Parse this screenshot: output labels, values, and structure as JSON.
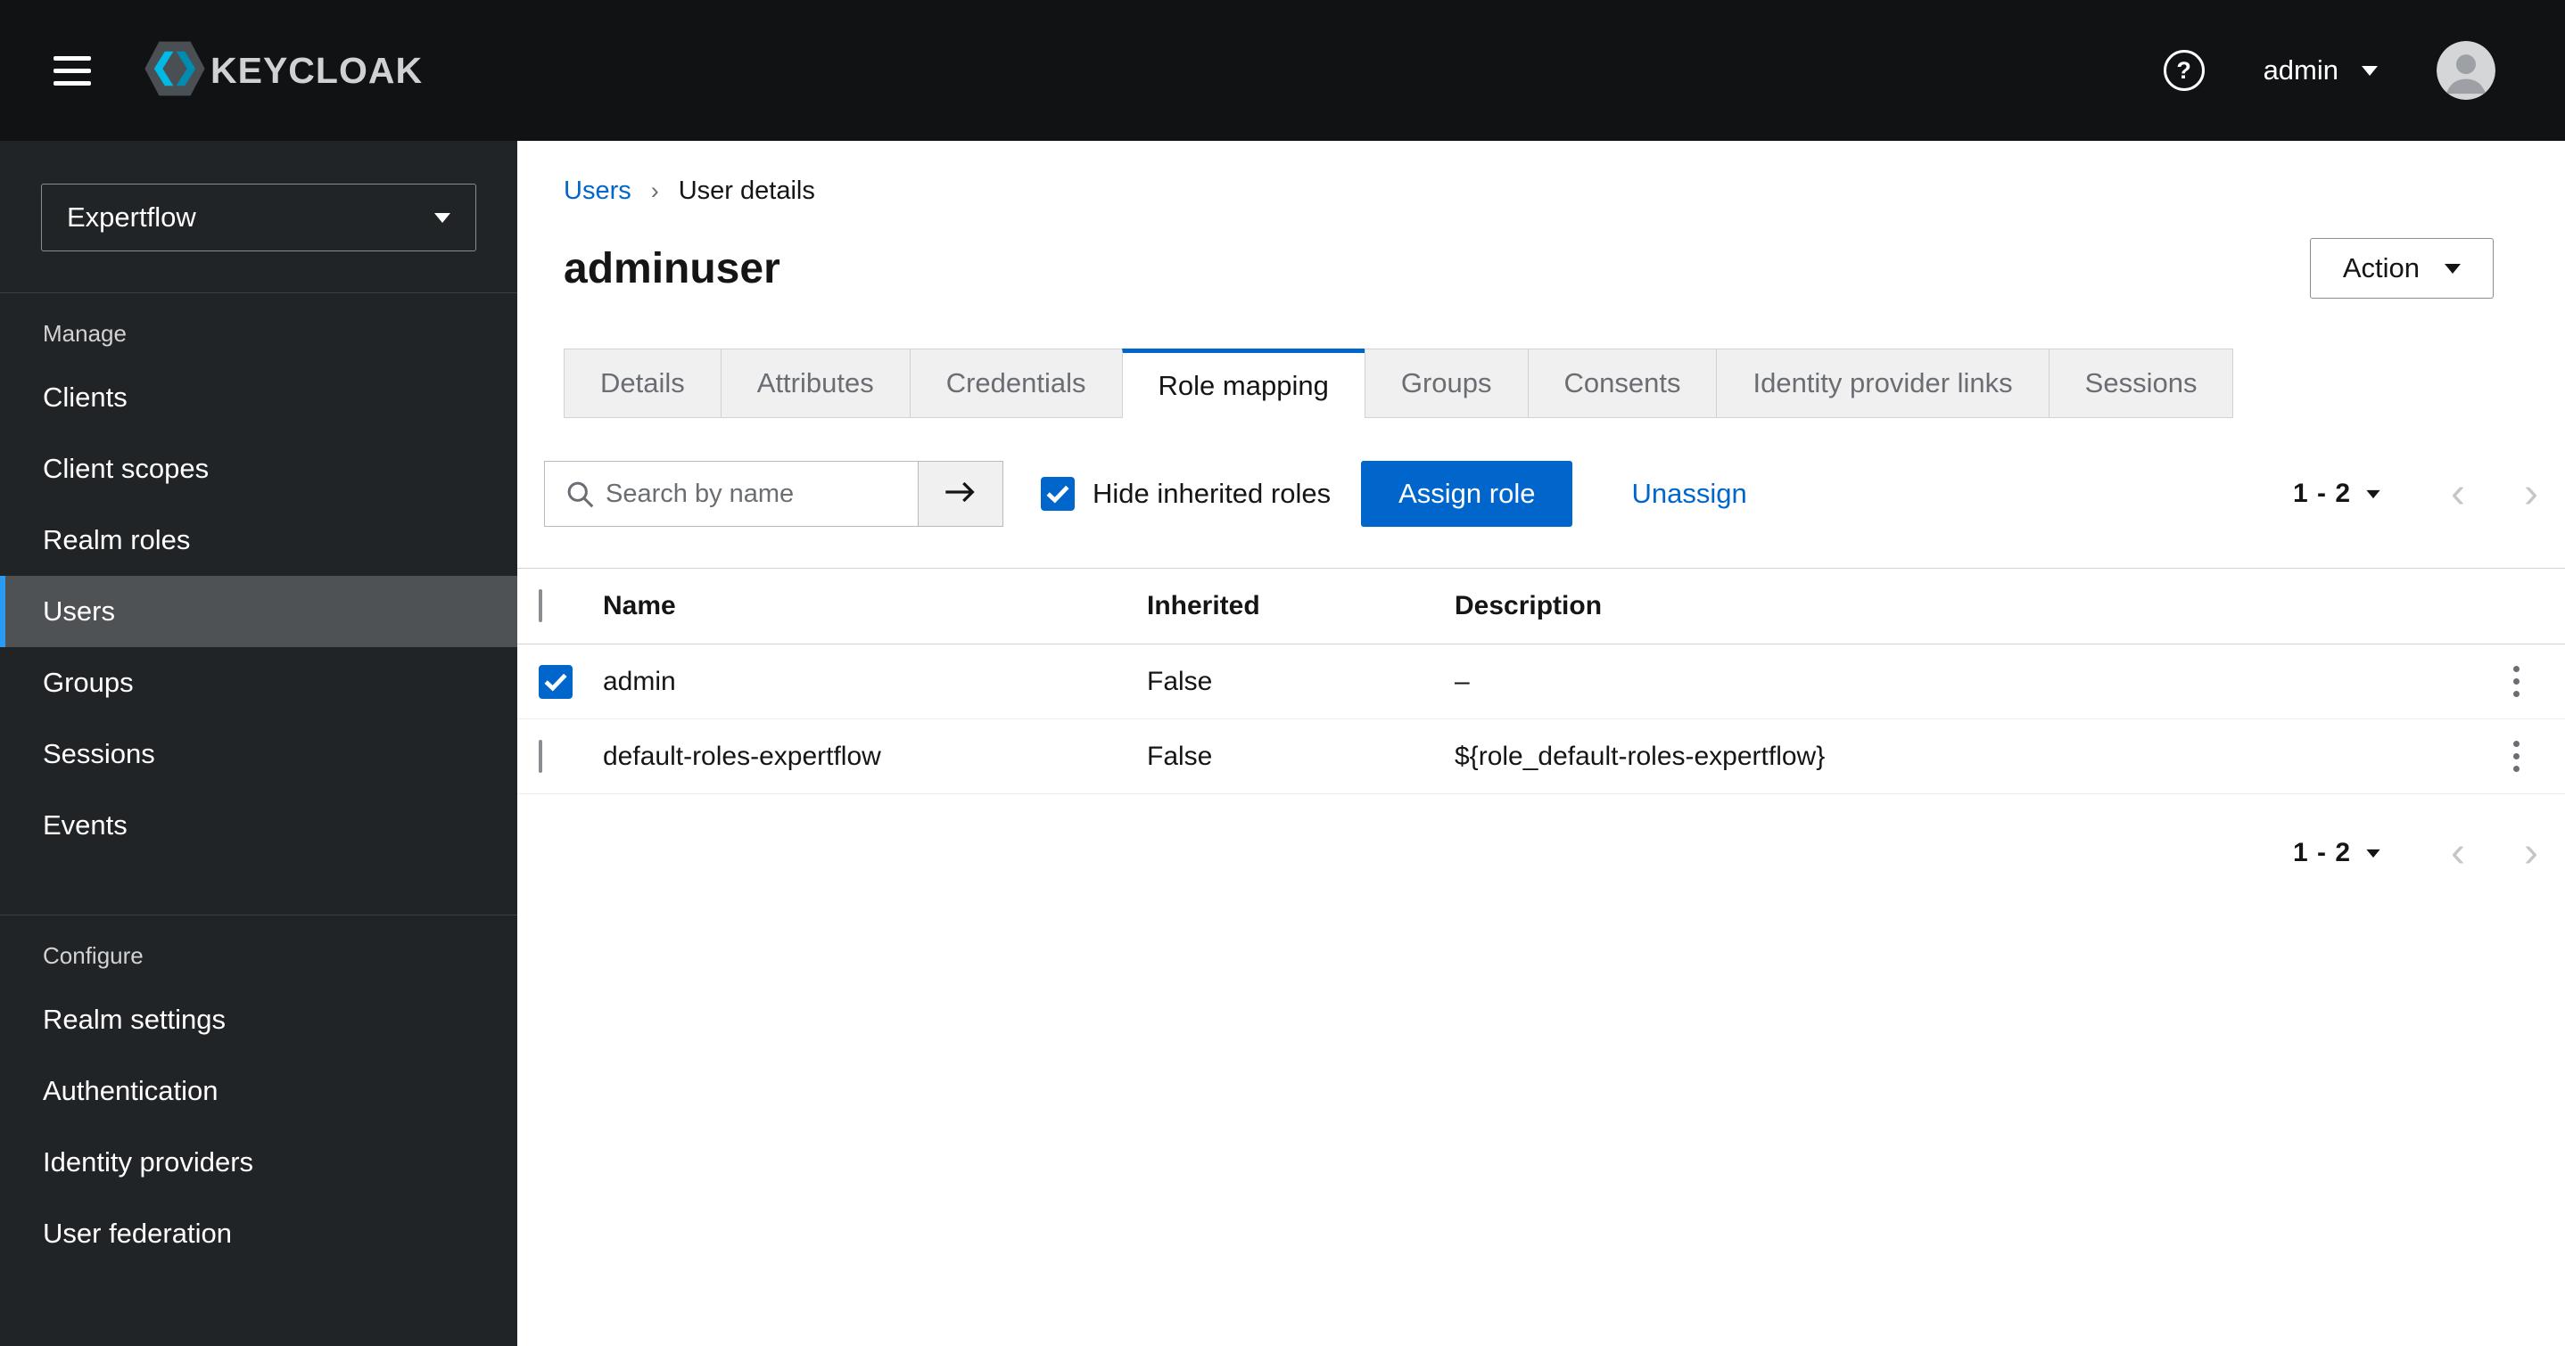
{
  "header": {
    "brand": "KEYCLOAK",
    "username": "admin"
  },
  "icons": {
    "help": "?",
    "breadcrumb_sep": "›",
    "chevron_left": "‹",
    "chevron_right": "›"
  },
  "sidebar": {
    "realm": "Expertflow",
    "manage_label": "Manage",
    "manage_items": [
      "Clients",
      "Client scopes",
      "Realm roles",
      "Users",
      "Groups",
      "Sessions",
      "Events"
    ],
    "configure_label": "Configure",
    "configure_items": [
      "Realm settings",
      "Authentication",
      "Identity providers",
      "User federation"
    ]
  },
  "breadcrumb": {
    "parent": "Users",
    "current": "User details"
  },
  "page": {
    "title": "adminuser",
    "action_label": "Action"
  },
  "tabs": [
    "Details",
    "Attributes",
    "Credentials",
    "Role mapping",
    "Groups",
    "Consents",
    "Identity provider links",
    "Sessions"
  ],
  "toolbar": {
    "search_placeholder": "Search by name",
    "hide_inherited_label": "Hide inherited roles",
    "assign_label": "Assign role",
    "unassign_label": "Unassign",
    "pagination": "1 - 2"
  },
  "table": {
    "headers": {
      "name": "Name",
      "inherited": "Inherited",
      "description": "Description"
    },
    "rows": [
      {
        "name": "admin",
        "inherited": "False",
        "description": "–",
        "checked": true
      },
      {
        "name": "default-roles-expertflow",
        "inherited": "False",
        "description": "${role_default-roles-expertflow}",
        "checked": false
      }
    ]
  },
  "footer": {
    "pagination": "1 - 2"
  },
  "colors": {
    "accent": "#0066cc",
    "header_bg": "#111214",
    "sidebar_bg": "#212427",
    "nav_selected_bg": "#4f5255",
    "nav_selected_border": "#2b9af3"
  }
}
